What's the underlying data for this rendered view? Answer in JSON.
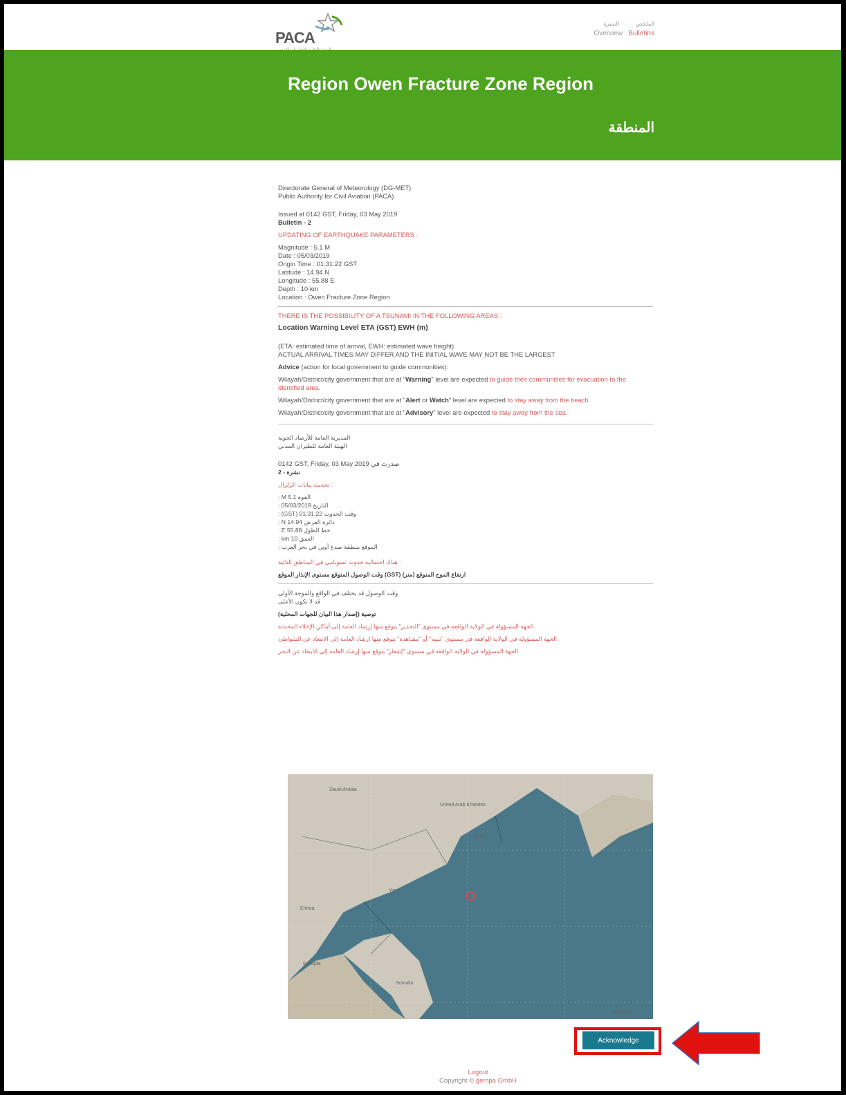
{
  "header": {
    "logo_text": "PACA",
    "logo_subtitle": "الهيئة العامة للطيران المدني",
    "nav_ar": [
      "النشرة",
      "الملخص"
    ],
    "nav_en": {
      "overview": "Overview",
      "bulletins": "Bulletins"
    }
  },
  "banner": {
    "title": "Region  Owen Fracture Zone Region",
    "title_ar": "المنطقة"
  },
  "english": {
    "org1": "Directorate General of Meteorology (DG-MET)",
    "org2": "Public Authority for Civil Aviation (PACA)",
    "issued": "Issued at 0142 GST, Friday, 03 May 2019",
    "bulletin": "Bulletin - 2",
    "updating": "UPDATING OF EARTHQUAKE PARAMETERS :",
    "params": [
      "Magnitude   : 5.1 M",
      "Date          : 05/03/2019",
      "Origin Time : 01:31:22 GST",
      "Latitude      : 14.94 N",
      "Longitude    : 55.88 E",
      "Depth         : 10 km",
      "Location      : Owen Fracture Zone Region"
    ],
    "possibility": "THERE IS THE POSSIBILITY OF A TSUNAMI IN THE FOLLOWING AREAS :",
    "table_header": "Location Warning Level ETA (GST) EWH (m)",
    "eta_note": "(ETA: estimated time of arrival, EWH: estimated wave height)",
    "arrival_note": "ACTUAL ARRIVAL TIMES MAY DIFFER AND THE INITIAL WAVE MAY NOT BE THE LARGEST",
    "advice_label": "Advice",
    "advice_rest": " (action for local government to guide communities):",
    "warning_pre": "Wilayah/District/city government that are at \"",
    "warning_word": "Warning",
    "warning_mid": "\" level are expected ",
    "warning_action": "to guide their communities for evacuation to the identified area.",
    "alert_pre": "Wilayah/District/city government that are at \"",
    "alert_word": "Alert",
    "alert_or": " or ",
    "watch_word": "Watch",
    "alert_mid": "\" level are expected ",
    "alert_action": "to stay away from the beach.",
    "advisory_pre": "Wilayah/District/city government that are at \"",
    "advisory_word": "Advisory",
    "advisory_mid": "\" level are expected ",
    "advisory_action": "to stay away from the sea."
  },
  "arabic": {
    "org1": "المديرية العامة للأرصاد الجوية",
    "org2": "الهيئة العامة للطيران المدني",
    "issued": "0142 GST, Friday, 03 May 2019 صدرت في",
    "bulletin": "نشرة - 2",
    "updating": ": تحديث بيانات الزلزال",
    "params": [
      "القوة      5.1 M :",
      "التاريخ     05/03/2019 :",
      "وقت الحدوث 01:31:22 (GST) :",
      "دائرة العرض 14.94 N :",
      "خط الطول   55.88 E :",
      "العمق       10 km :",
      "الموقع     منطقة صدع أوين في بحر العرب :"
    ],
    "possibility": ": هناك احتمالية حدوث تسونامي في المناطق التالية",
    "table_header": "ارتفاع الموج المتوقع (متر) (GST) وقت الوصول المتوقع مستوى الإنذار الموقع",
    "arrival_note1": "وقت الوصول قد يختلف في الواقع والموجة الأولى",
    "arrival_note2": "قد لا تكون الأعلى",
    "advice": "توصية (إصدار هذا البيان للجهات المحلية)",
    "warning": ".الجهة المسؤولة في الولاية الواقعة في مستوى \"التحذير\" يتوقع منها إرشاد العامة إلى أماكن الإخلاء المحددة",
    "alert": ".الجهة المسؤولة في الولاية الواقعة في مستوى \"تنبيه\" أو \"مشاهدة\" يتوقع منها إرشاد العامة إلى الابتعاد عن الشواطئ",
    "advisory": ".الجهة المسؤولة في الولاية الواقعة في مستوى \"إشعار\" يتوقع منها إرشاد العامة إلى الابتعاد عن البحر"
  },
  "map": {
    "labels": [
      "Saudi Arabia",
      "United Arab Emirates",
      "Oman",
      "Yemen",
      "Eritrea",
      "Ethiopia",
      "Somalia",
      "Maldives"
    ],
    "marker": "epicenter"
  },
  "acknowledge_label": "Acknowledge",
  "footer": {
    "logout": "Logout",
    "copyright_prefix": "Copyright © ",
    "copyright_brand": "gempa GmbH"
  },
  "colors": {
    "banner": "#4ea41e",
    "accent_red": "#d85a5a",
    "button": "#197a8f",
    "highlight": "#e0120f"
  }
}
